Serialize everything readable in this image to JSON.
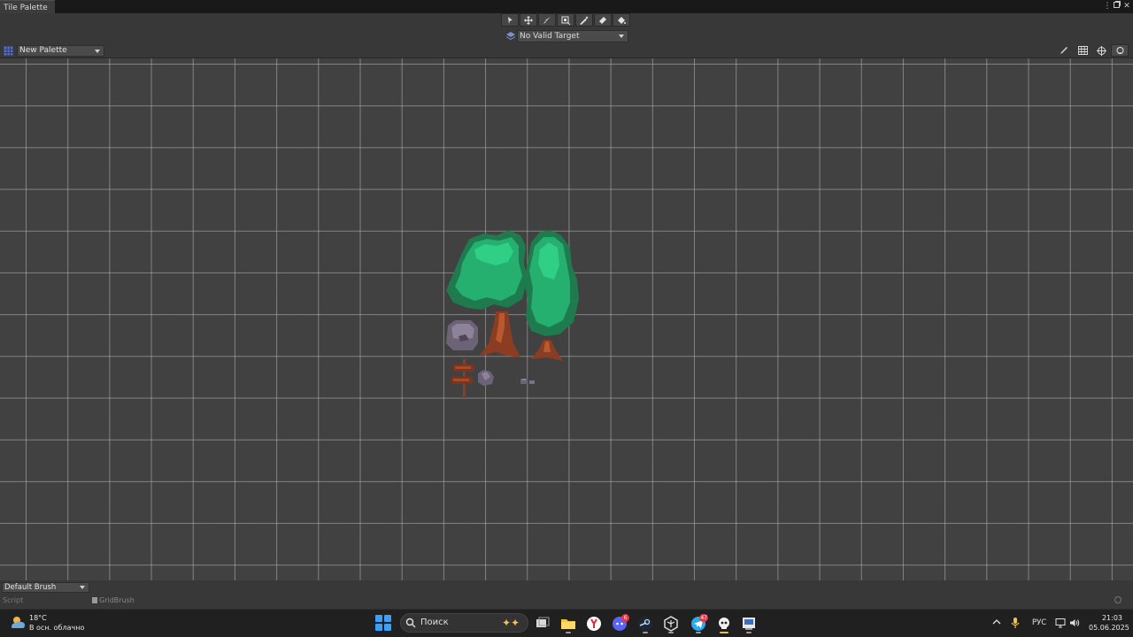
{
  "window": {
    "tab_title": "Tile Palette",
    "menu_icon": "kebab-menu-icon",
    "maximize_icon": "maximize-icon",
    "close_icon": "close-icon",
    "close_glyph": "✕"
  },
  "toolbar": {
    "tools": [
      {
        "name": "select",
        "icon": "arrow-pointer-icon"
      },
      {
        "name": "move",
        "icon": "move-arrows-icon"
      },
      {
        "name": "paint",
        "icon": "paintbrush-icon"
      },
      {
        "name": "box-fill",
        "icon": "box-fill-icon"
      },
      {
        "name": "pick",
        "icon": "eyedropper-icon"
      },
      {
        "name": "erase",
        "icon": "eraser-icon"
      },
      {
        "name": "flood-fill",
        "icon": "paint-bucket-icon"
      }
    ],
    "active_target": "No Valid Target"
  },
  "palette": {
    "selected": "New Palette",
    "right_tools": [
      {
        "name": "edit",
        "icon": "pencil-icon"
      },
      {
        "name": "grid",
        "icon": "grid-icon"
      },
      {
        "name": "gizmos",
        "icon": "gizmo-icon"
      },
      {
        "name": "scene-view",
        "icon": "scene-filter-icon"
      }
    ]
  },
  "canvas": {
    "grid": true,
    "tiles": [
      "tree-large",
      "tree-tall",
      "rock",
      "signpost",
      "small-rock",
      "pebbles"
    ]
  },
  "brush": {
    "selected": "Default Brush",
    "script_label": "Script",
    "script_value": "GridBrush"
  },
  "taskbar": {
    "weather": {
      "temp": "18°C",
      "desc": "В осн. облачно",
      "icon": "cloud-sun-icon"
    },
    "search_placeholder": "Поиск",
    "apps": [
      {
        "name": "task-view",
        "icon": "task-view-icon",
        "badge": ""
      },
      {
        "name": "file-explorer",
        "icon": "folder-icon",
        "badge": ""
      },
      {
        "name": "yandex-browser",
        "icon": "yandex-icon",
        "badge": ""
      },
      {
        "name": "discord",
        "icon": "discord-icon",
        "badge": "6"
      },
      {
        "name": "steam",
        "icon": "steam-icon",
        "badge": ""
      },
      {
        "name": "unity-hub",
        "icon": "unity-icon",
        "badge": ""
      },
      {
        "name": "telegram",
        "icon": "telegram-icon",
        "badge": "47"
      },
      {
        "name": "unity-editor",
        "icon": "unity-editor-icon",
        "badge": ""
      },
      {
        "name": "visual-studio",
        "icon": "visual-studio-icon",
        "badge": ""
      }
    ],
    "tray": {
      "language": "РУС",
      "time": "21:03",
      "date": "05.06.2025"
    }
  }
}
